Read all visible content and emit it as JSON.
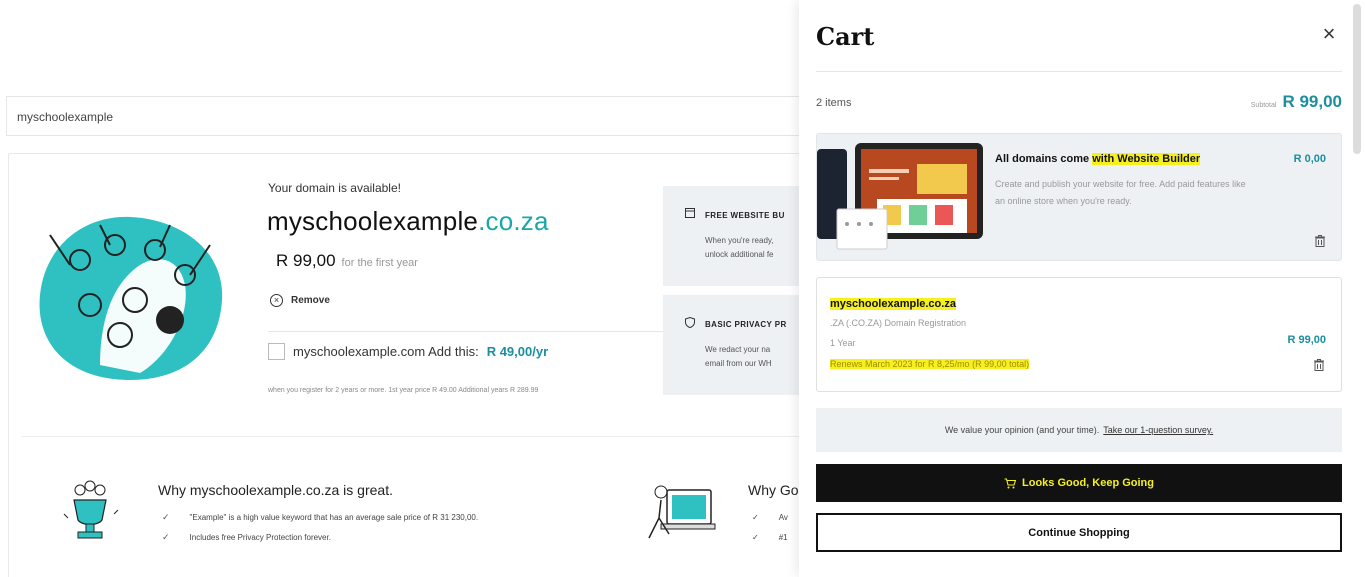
{
  "search": {
    "value": "myschoolexample"
  },
  "result": {
    "availability_text": "Your domain is available!",
    "domain_sld": "myschoolexample",
    "domain_tld": ".co.za",
    "price": "R 99,00",
    "price_term": "for the first year",
    "remove_label": "Remove",
    "upsell_text": "myschoolexample.com Add this:",
    "upsell_price": "R 49,00/yr",
    "fineprint": "when you register for 2 years or more. 1st year price R 49.00 Additional years R 289.99",
    "features": [
      {
        "title": "FREE WEBSITE BU",
        "desc_lines": [
          "When you're ready,",
          "unlock additional fe"
        ]
      },
      {
        "title": "BASIC PRIVACY PR",
        "desc_lines": [
          "We redact your na",
          "email from our WH"
        ]
      }
    ]
  },
  "why": {
    "title": "Why myschoolexample.co.za is great.",
    "items": [
      "\"Example\" is a high value keyword that has an average sale price of R 31 230,00.",
      "Includes free Privacy Protection forever."
    ]
  },
  "why2": {
    "title": "Why Go",
    "items": [
      "Av",
      "#1"
    ]
  },
  "cart": {
    "title": "Cart",
    "items_count": "2 items",
    "subtotal_label": "Subtotal",
    "subtotal_amount": "R 99,00",
    "website_builder": {
      "title_prefix": "All domains come ",
      "title_highlight": "with Website Builder",
      "description": "Create and publish your website for free. Add paid features like an online store when you're ready.",
      "price": "R 0,00"
    },
    "domain_item": {
      "name": "myschoolexample.co.za",
      "type": ".ZA (.CO.ZA) Domain Registration",
      "term": "1 Year",
      "renewal": "Renews March 2023 for R 8,25/mo (R 99,00 total)",
      "price": "R 99,00"
    },
    "survey_text": "We value your opinion (and your time).",
    "survey_link": "Take our 1-question survey.",
    "primary_button": "Looks Good, Keep Going",
    "secondary_button": "Continue Shopping"
  },
  "colors": {
    "accent_teal": "#1b8e9f",
    "highlight_yellow": "#f7f01f",
    "button_dark": "#111111"
  }
}
